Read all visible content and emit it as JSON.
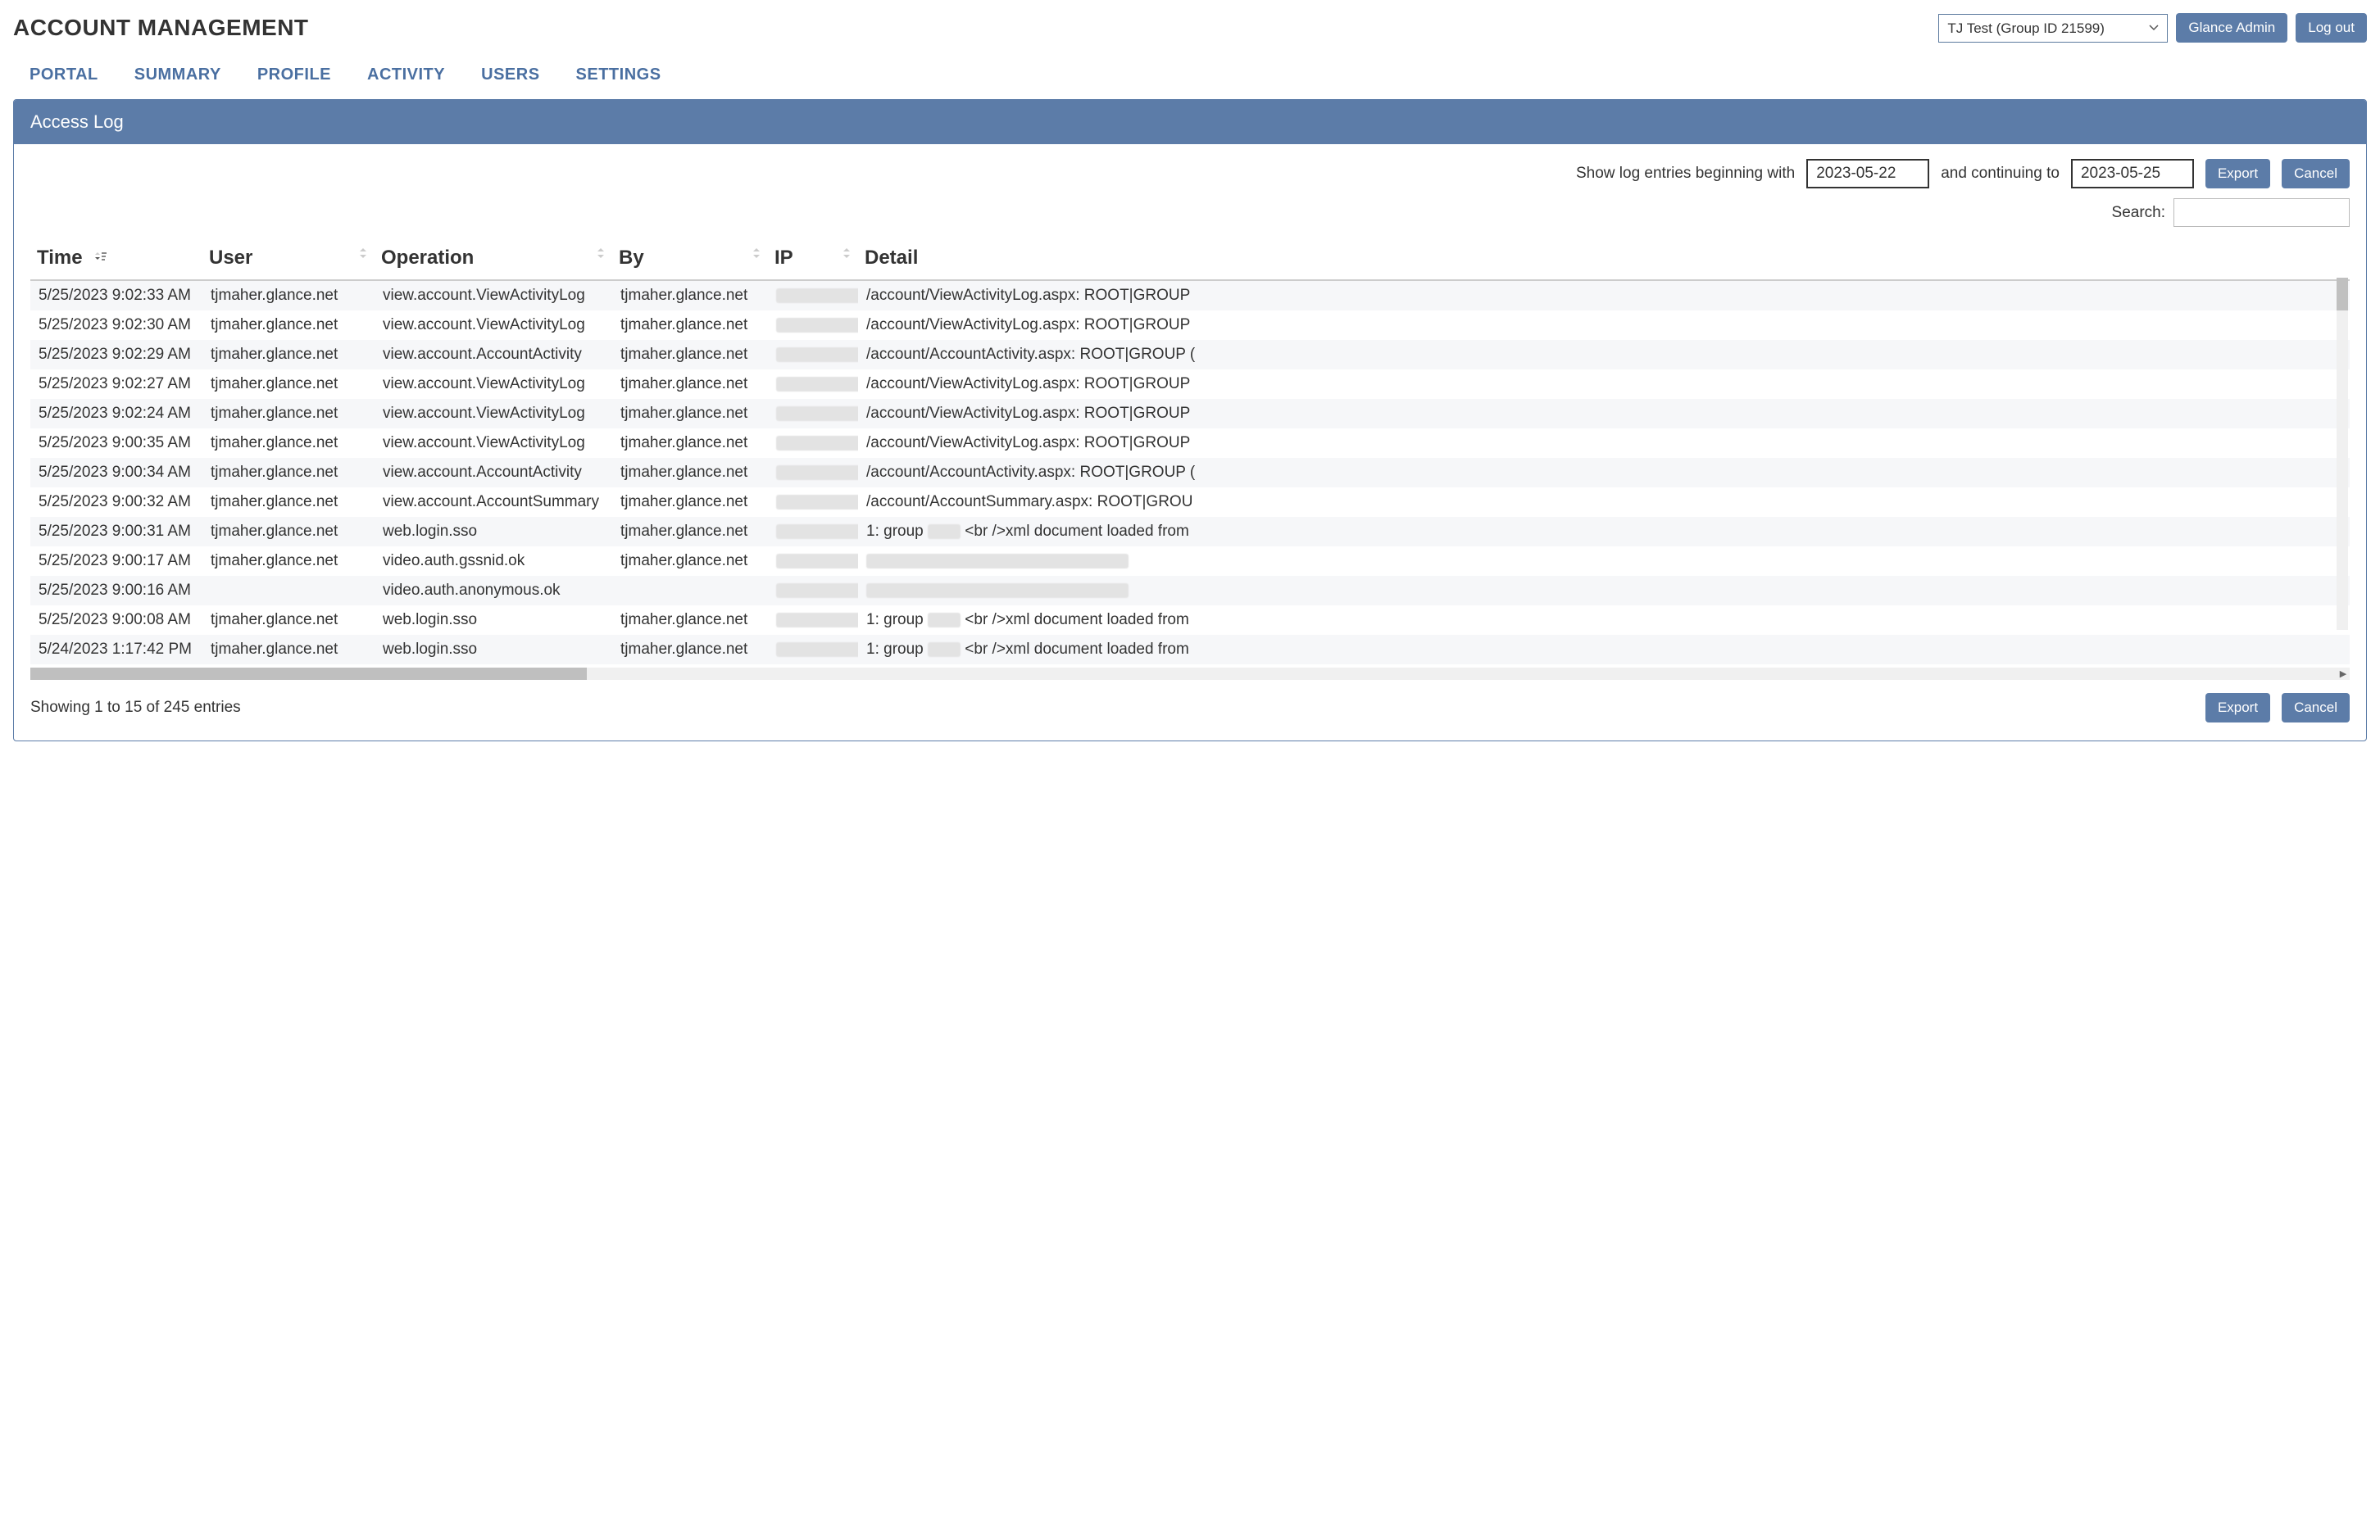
{
  "header": {
    "title": "ACCOUNT MANAGEMENT",
    "group_selected": "TJ Test (Group ID 21599)",
    "glance_admin_label": "Glance Admin",
    "logout_label": "Log out"
  },
  "tabs": [
    {
      "label": "PORTAL"
    },
    {
      "label": "SUMMARY"
    },
    {
      "label": "PROFILE"
    },
    {
      "label": "ACTIVITY"
    },
    {
      "label": "USERS"
    },
    {
      "label": "SETTINGS"
    }
  ],
  "panel": {
    "title": "Access Log",
    "filter": {
      "prefix": "Show log entries beginning with",
      "start_date": "2023-05-22",
      "middle": "and continuing to",
      "end_date": "2023-05-25",
      "export_label": "Export",
      "cancel_label": "Cancel"
    },
    "search": {
      "label": "Search:",
      "value": ""
    },
    "columns": [
      "Time",
      "User",
      "Operation",
      "By",
      "IP",
      "Detail"
    ],
    "rows": [
      {
        "time": "5/25/2023 9:02:33 AM",
        "user": "tjmaher.glance.net",
        "op": "view.account.ViewActivityLog",
        "by": "tjmaher.glance.net",
        "ip": "",
        "detail": "/account/ViewActivityLog.aspx: ROOT|GROUP"
      },
      {
        "time": "5/25/2023 9:02:30 AM",
        "user": "tjmaher.glance.net",
        "op": "view.account.ViewActivityLog",
        "by": "tjmaher.glance.net",
        "ip": "",
        "detail": "/account/ViewActivityLog.aspx: ROOT|GROUP"
      },
      {
        "time": "5/25/2023 9:02:29 AM",
        "user": "tjmaher.glance.net",
        "op": "view.account.AccountActivity",
        "by": "tjmaher.glance.net",
        "ip": "",
        "detail": "/account/AccountActivity.aspx: ROOT|GROUP ("
      },
      {
        "time": "5/25/2023 9:02:27 AM",
        "user": "tjmaher.glance.net",
        "op": "view.account.ViewActivityLog",
        "by": "tjmaher.glance.net",
        "ip": "",
        "detail": "/account/ViewActivityLog.aspx: ROOT|GROUP"
      },
      {
        "time": "5/25/2023 9:02:24 AM",
        "user": "tjmaher.glance.net",
        "op": "view.account.ViewActivityLog",
        "by": "tjmaher.glance.net",
        "ip": "",
        "detail": "/account/ViewActivityLog.aspx: ROOT|GROUP"
      },
      {
        "time": "5/25/2023 9:00:35 AM",
        "user": "tjmaher.glance.net",
        "op": "view.account.ViewActivityLog",
        "by": "tjmaher.glance.net",
        "ip": "",
        "detail": "/account/ViewActivityLog.aspx: ROOT|GROUP"
      },
      {
        "time": "5/25/2023 9:00:34 AM",
        "user": "tjmaher.glance.net",
        "op": "view.account.AccountActivity",
        "by": "tjmaher.glance.net",
        "ip": "",
        "detail": "/account/AccountActivity.aspx: ROOT|GROUP ("
      },
      {
        "time": "5/25/2023 9:00:32 AM",
        "user": "tjmaher.glance.net",
        "op": "view.account.AccountSummary",
        "by": "tjmaher.glance.net",
        "ip": "",
        "detail": "/account/AccountSummary.aspx: ROOT|GROU"
      },
      {
        "time": "5/25/2023 9:00:31 AM",
        "user": "tjmaher.glance.net",
        "op": "web.login.sso",
        "by": "tjmaher.glance.net",
        "ip": "",
        "detail": "1: group        <br />xml document loaded from "
      },
      {
        "time": "5/25/2023 9:00:17 AM",
        "user": "tjmaher.glance.net",
        "op": "video.auth.gssnid.ok",
        "by": "tjmaher.glance.net",
        "ip": "",
        "detail": ""
      },
      {
        "time": "5/25/2023 9:00:16 AM",
        "user": "",
        "op": "video.auth.anonymous.ok",
        "by": "",
        "ip": "",
        "detail": ""
      },
      {
        "time": "5/25/2023 9:00:08 AM",
        "user": "tjmaher.glance.net",
        "op": "web.login.sso",
        "by": "tjmaher.glance.net",
        "ip": "",
        "detail": "1: group        <br />xml document loaded from "
      },
      {
        "time": "5/24/2023 1:17:42 PM",
        "user": "tjmaher.glance.net",
        "op": "web.login.sso",
        "by": "tjmaher.glance.net",
        "ip": "",
        "detail": "1: group        <br />xml document loaded from "
      }
    ],
    "entries_info": "Showing 1 to 15 of 245 entries",
    "footer": {
      "export_label": "Export",
      "cancel_label": "Cancel"
    }
  }
}
